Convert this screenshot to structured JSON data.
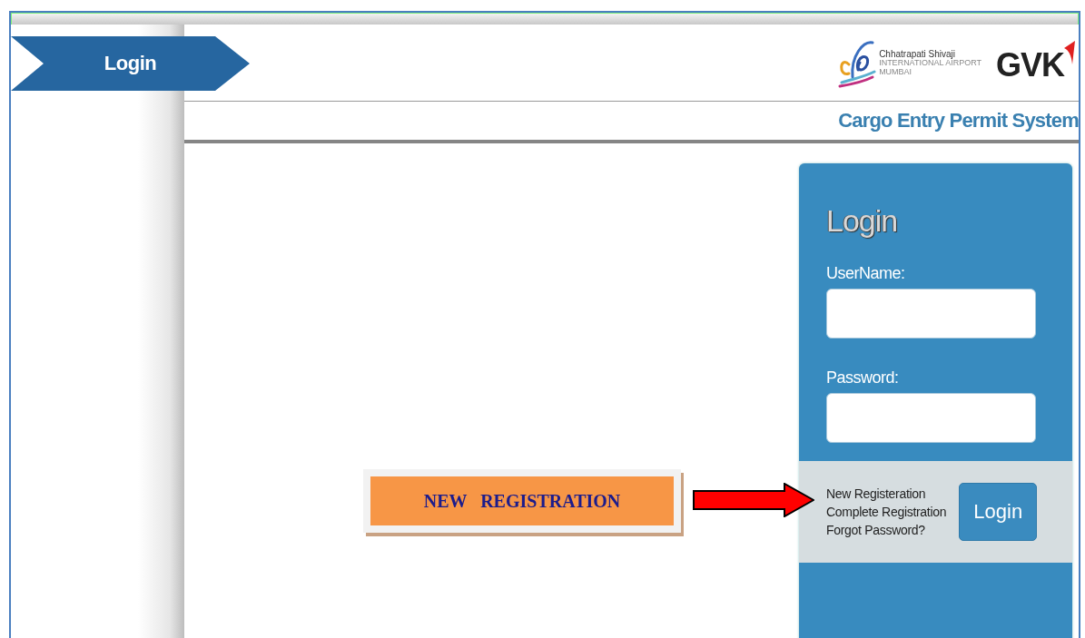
{
  "ribbon": {
    "label": "Login"
  },
  "header": {
    "airport_logo": {
      "name": "Chhatrapati Shivaji",
      "line_2": "INTERNATIONAL AIRPORT",
      "line_3": "MUMBAI"
    },
    "company_logo": "GVK"
  },
  "subtitle": "Cargo Entry Permit System",
  "login_panel": {
    "title": "Login",
    "fields": [
      {
        "label": "UserName:"
      },
      {
        "label": "Password:"
      }
    ],
    "links": [
      "New Registeration",
      "Complete Registration",
      "Forgot Password?"
    ],
    "button": "Login"
  },
  "annotation": {
    "callout": "NEW   REGISTRATION"
  }
}
